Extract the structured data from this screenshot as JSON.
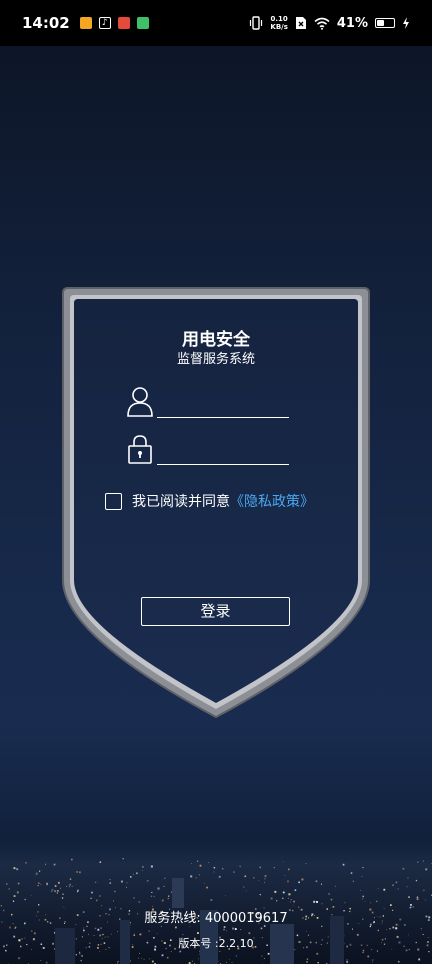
{
  "status_bar": {
    "time": "14:02",
    "app_icons": [
      "weibo-icon",
      "tiktok-icon",
      "shopping-icon",
      "messenger-icon"
    ],
    "net_speed_value": "0.10",
    "net_speed_unit": "KB/s",
    "battery_percent": "41%",
    "battery_level": 0.41
  },
  "login": {
    "title": "用电安全",
    "subtitle": "监督服务系统",
    "username": {
      "value": "",
      "icon": "user-icon"
    },
    "password": {
      "value": "",
      "icon": "lock-icon"
    },
    "agree_text": "我已阅读并同意",
    "privacy_link": "《隐私政策》",
    "login_button": "登录"
  },
  "footer": {
    "hotline": "服务热线: 4000019617",
    "version": "版本号 :2.2.10"
  },
  "colors": {
    "background": "#17294a",
    "shield_border": "#9a9ca3",
    "link": "#4aa8f0"
  }
}
